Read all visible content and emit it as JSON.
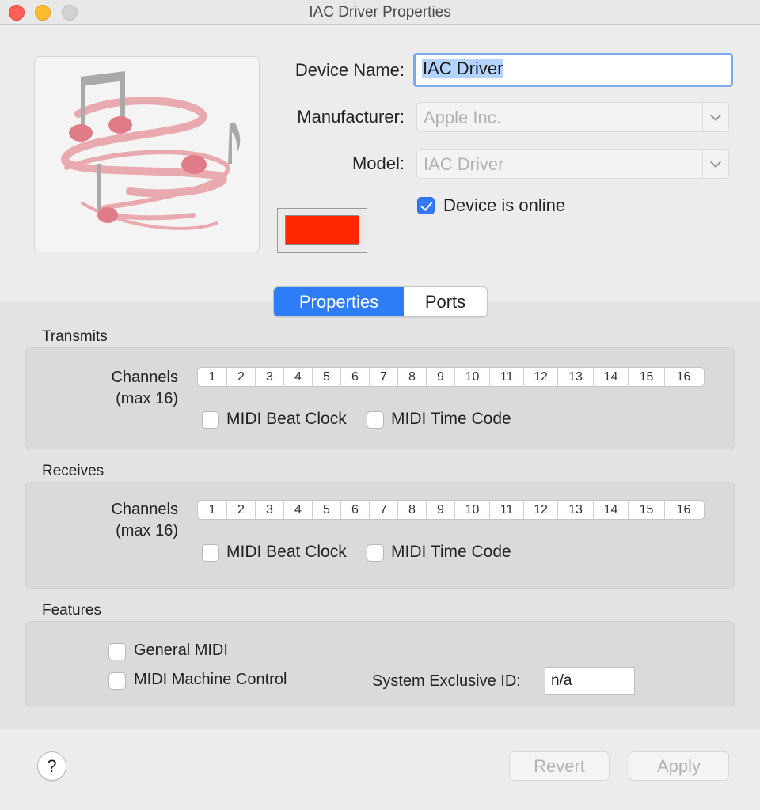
{
  "window": {
    "title": "IAC Driver Properties"
  },
  "device": {
    "name_label": "Device Name:",
    "name_value": "IAC Driver",
    "manufacturer_label": "Manufacturer:",
    "manufacturer_value": "Apple Inc.",
    "model_label": "Model:",
    "model_value": "IAC Driver",
    "online_label": "Device is online",
    "online_checked": true,
    "color": "#ff2600"
  },
  "tabs": [
    {
      "label": "Properties",
      "active": true
    },
    {
      "label": "Ports",
      "active": false
    }
  ],
  "transmits": {
    "title": "Transmits",
    "channels_label": "Channels",
    "channels_sub": "(max 16)",
    "channels": [
      "1",
      "2",
      "3",
      "4",
      "5",
      "6",
      "7",
      "8",
      "9",
      "10",
      "11",
      "12",
      "13",
      "14",
      "15",
      "16"
    ],
    "beat_clock": "MIDI Beat Clock",
    "time_code": "MIDI Time Code"
  },
  "receives": {
    "title": "Receives",
    "channels_label": "Channels",
    "channels_sub": "(max 16)",
    "channels": [
      "1",
      "2",
      "3",
      "4",
      "5",
      "6",
      "7",
      "8",
      "9",
      "10",
      "11",
      "12",
      "13",
      "14",
      "15",
      "16"
    ],
    "beat_clock": "MIDI Beat Clock",
    "time_code": "MIDI Time Code"
  },
  "features": {
    "title": "Features",
    "general_midi": "General MIDI",
    "machine_control": "MIDI Machine Control",
    "sysex_label": "System Exclusive ID:",
    "sysex_value": "n/a"
  },
  "footer": {
    "help": "?",
    "revert": "Revert",
    "apply": "Apply"
  }
}
